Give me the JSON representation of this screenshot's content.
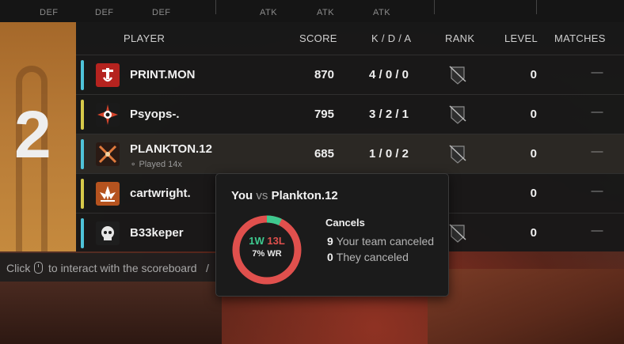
{
  "columns_top": [
    "DEF",
    "DEF",
    "DEF",
    "ATK",
    "ATK",
    "ATK"
  ],
  "header": {
    "player": "PLAYER",
    "score": "SCORE",
    "kda": "K / D / A",
    "rank": "RANK",
    "level": "LEVEL",
    "matches": "MATCHES"
  },
  "team": {
    "rank": "2",
    "color": "#b27534"
  },
  "players": [
    {
      "name": "PRINT.MON",
      "sub": "",
      "score": "870",
      "kda": "4 / 0 / 0",
      "level": "0",
      "matches": "—",
      "bar_color": "#4fc3d9",
      "icon": "operator-icon-red-hook",
      "highlight": false
    },
    {
      "name": "Psyops-.",
      "sub": "",
      "score": "795",
      "kda": "3 / 2 / 1",
      "level": "0",
      "matches": "—",
      "bar_color": "#d6c94a",
      "icon": "operator-icon-star-eye",
      "highlight": false
    },
    {
      "name": "PLANKTON.12",
      "sub": "Played 14x",
      "score": "685",
      "kda": "1 / 0 / 2",
      "level": "0",
      "matches": "—",
      "bar_color": "#4fc3d9",
      "icon": "operator-icon-crossed-x",
      "highlight": true
    },
    {
      "name": "cartwright.",
      "sub": "",
      "score": "",
      "kda": "",
      "level": "0",
      "matches": "—",
      "bar_color": "#d6c94a",
      "icon": "operator-icon-flower",
      "highlight": false
    },
    {
      "name": "B33keper",
      "sub": "",
      "score": "",
      "kda": "",
      "level": "0",
      "matches": "—",
      "bar_color": "#4fc3d9",
      "icon": "operator-icon-skull",
      "highlight": false
    }
  ],
  "hint": {
    "prefix": "Click",
    "suffix": "to interact with the scoreboard",
    "sep": "/"
  },
  "popup": {
    "you": "You",
    "vs": "vs",
    "opponent": "Plankton.12",
    "wins_label": "1W",
    "losses_label": "13L",
    "wr_label": "7% WR",
    "wins": 1,
    "losses": 13,
    "win_color": "#3ec98f",
    "loss_color": "#e0504d",
    "cancels_title": "Cancels",
    "your_team_canceled_count": "9",
    "your_team_canceled_label": "Your team canceled",
    "they_canceled_count": "0",
    "they_canceled_label": "They canceled"
  }
}
